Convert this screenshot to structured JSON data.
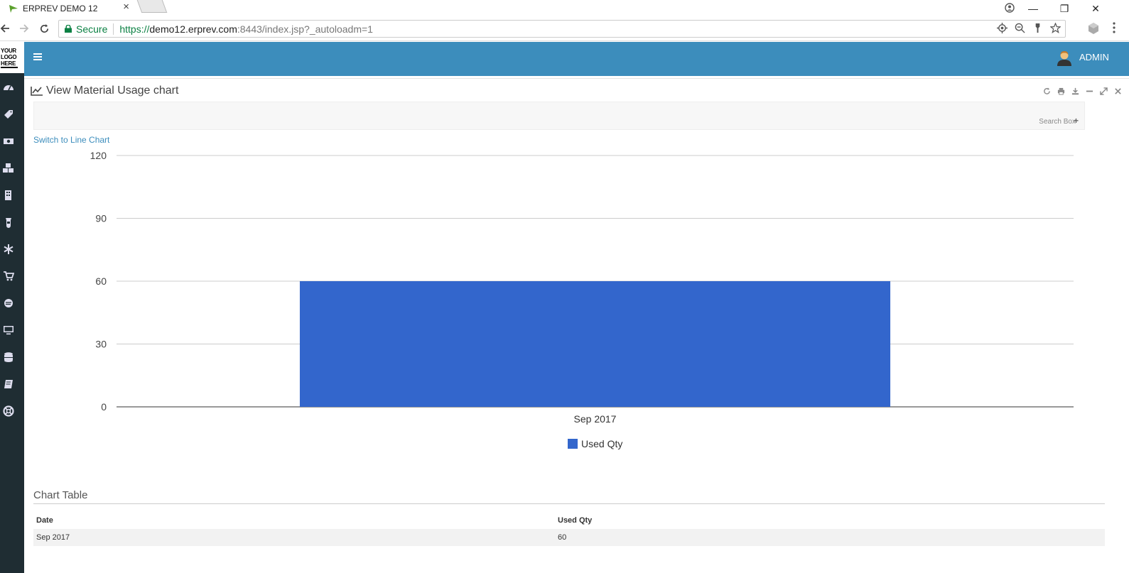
{
  "browser": {
    "tab_title": "ERPREV DEMO 12",
    "secure_label": "Secure",
    "url_scheme": "https://",
    "url_host": "demo12.erprev.com",
    "url_rest": ":8443/index.jsp?_autoloadm=1"
  },
  "app": {
    "logo_lines": [
      "YOUR",
      "LOGO",
      "HERE"
    ],
    "user_name": "ADMIN",
    "accent_color": "#3c8dbc",
    "sidebar_color": "#1f2d33",
    "sidebar_icons": [
      "dashboard-icon",
      "tag-icon",
      "money-icon",
      "cubes-icon",
      "building-icon",
      "flask-icon",
      "snowflake-icon",
      "cart-icon",
      "circle-icon",
      "desktop-icon",
      "database-icon",
      "book-icon",
      "lifebuoy-icon"
    ]
  },
  "panel": {
    "title": "View Material Usage chart",
    "search_box_label": "Search Box",
    "switch_link": "Switch to Line Chart",
    "tools": [
      "refresh-icon",
      "print-icon",
      "download-icon",
      "minimize-icon",
      "expand-icon",
      "close-icon"
    ]
  },
  "chart_data": {
    "type": "bar",
    "categories": [
      "Sep 2017"
    ],
    "series": [
      {
        "name": "Used Qty",
        "values": [
          60
        ],
        "color": "#3366cc"
      }
    ],
    "ylim": [
      0,
      120
    ],
    "yticks": [
      0,
      30,
      60,
      90,
      120
    ],
    "grid": true,
    "legend": "bottom"
  },
  "table": {
    "title": "Chart Table",
    "headers": [
      "Date",
      "Used Qty"
    ],
    "rows": [
      [
        "Sep 2017",
        "60"
      ]
    ]
  }
}
